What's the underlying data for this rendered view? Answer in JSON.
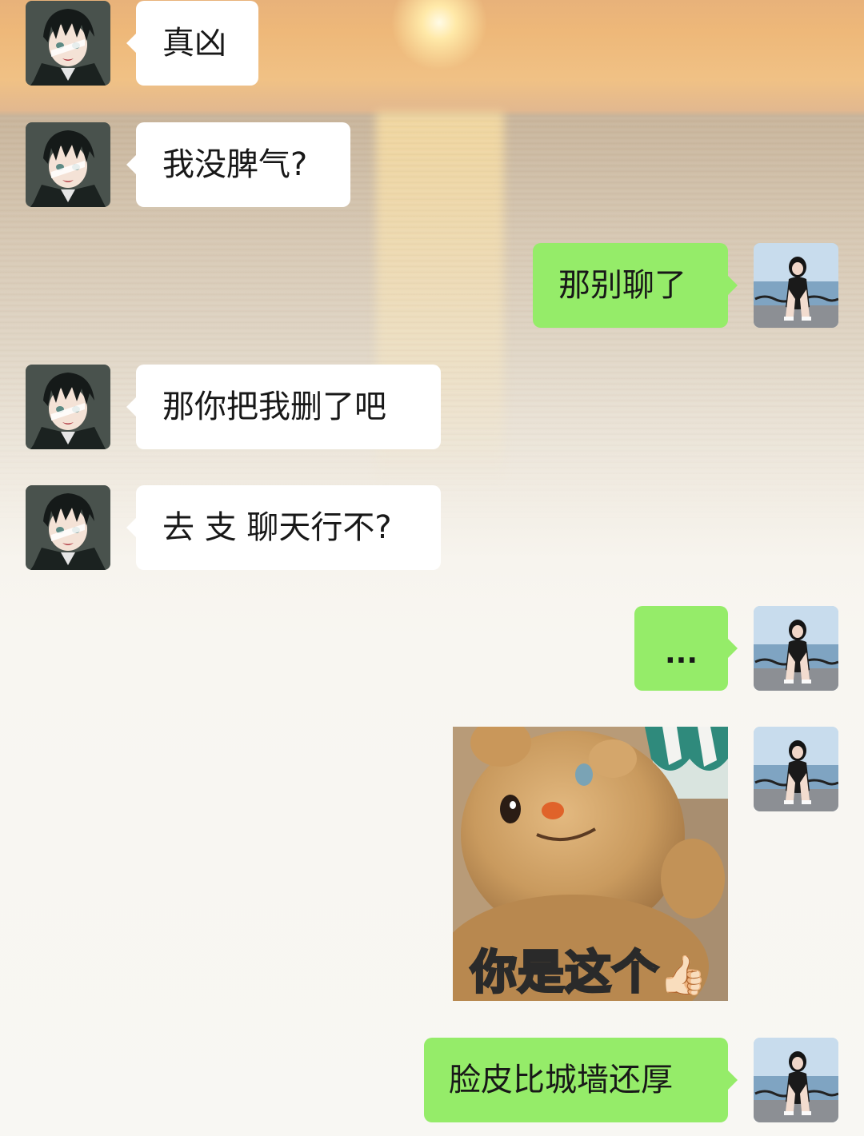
{
  "conversation": {
    "messages": [
      {
        "side": "left",
        "type": "text",
        "text": "真凶"
      },
      {
        "side": "left",
        "type": "text",
        "text": "我没脾气?"
      },
      {
        "side": "right",
        "type": "text",
        "text": "那别聊了"
      },
      {
        "side": "left",
        "type": "text",
        "text": "那你把我删了吧"
      },
      {
        "side": "left",
        "type": "text",
        "text": "去 支 聊天行不?"
      },
      {
        "side": "right",
        "type": "text",
        "text": "..."
      },
      {
        "side": "right",
        "type": "sticker",
        "caption": "你是这个",
        "emoji": "👍🏻",
        "icon": "teddy-bear-thumbs-up-sticker"
      },
      {
        "side": "right",
        "type": "text",
        "text": "脸皮比城墙还厚"
      }
    ]
  },
  "colors": {
    "bubble_self": "#95ec69",
    "bubble_other": "#ffffff",
    "text": "#181818"
  },
  "icons": {
    "other_avatar": "anime-boy-avatar",
    "self_avatar": "girl-photo-avatar"
  }
}
